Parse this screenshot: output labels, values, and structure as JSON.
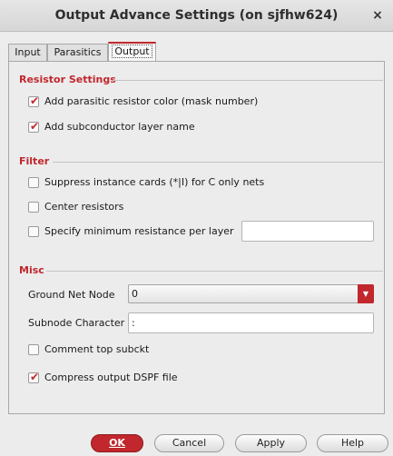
{
  "window": {
    "title": "Output Advance Settings (on sjfhw624)",
    "close_glyph": "×"
  },
  "tabs": [
    {
      "label": "Input"
    },
    {
      "label": "Parasitics"
    },
    {
      "label": "Output",
      "active": true
    }
  ],
  "resistor_settings": {
    "title": "Resistor Settings",
    "items": [
      {
        "label": "Add parasitic resistor color (mask number)",
        "checked": true
      },
      {
        "label": "Add subconductor layer name",
        "checked": true
      }
    ]
  },
  "filter": {
    "title": "Filter",
    "items": [
      {
        "label": "Suppress instance cards (*|I) for C only nets",
        "checked": false
      },
      {
        "label": "Center resistors",
        "checked": false
      },
      {
        "label": "Specify minimum resistance per layer",
        "checked": false
      }
    ],
    "min_resistance_value": ""
  },
  "misc": {
    "title": "Misc",
    "ground_net_node_label": "Ground Net Node",
    "ground_net_node_value": "0",
    "subnode_character_label": "Subnode Character",
    "subnode_character_value": ":",
    "items": [
      {
        "label": "Comment top subckt",
        "checked": false
      },
      {
        "label": "Compress output DSPF file",
        "checked": true
      }
    ]
  },
  "buttons": {
    "ok": "OK",
    "cancel": "Cancel",
    "apply": "Apply",
    "help": "Help"
  },
  "colors": {
    "accent": "#c1272d",
    "background": "#ececec"
  }
}
